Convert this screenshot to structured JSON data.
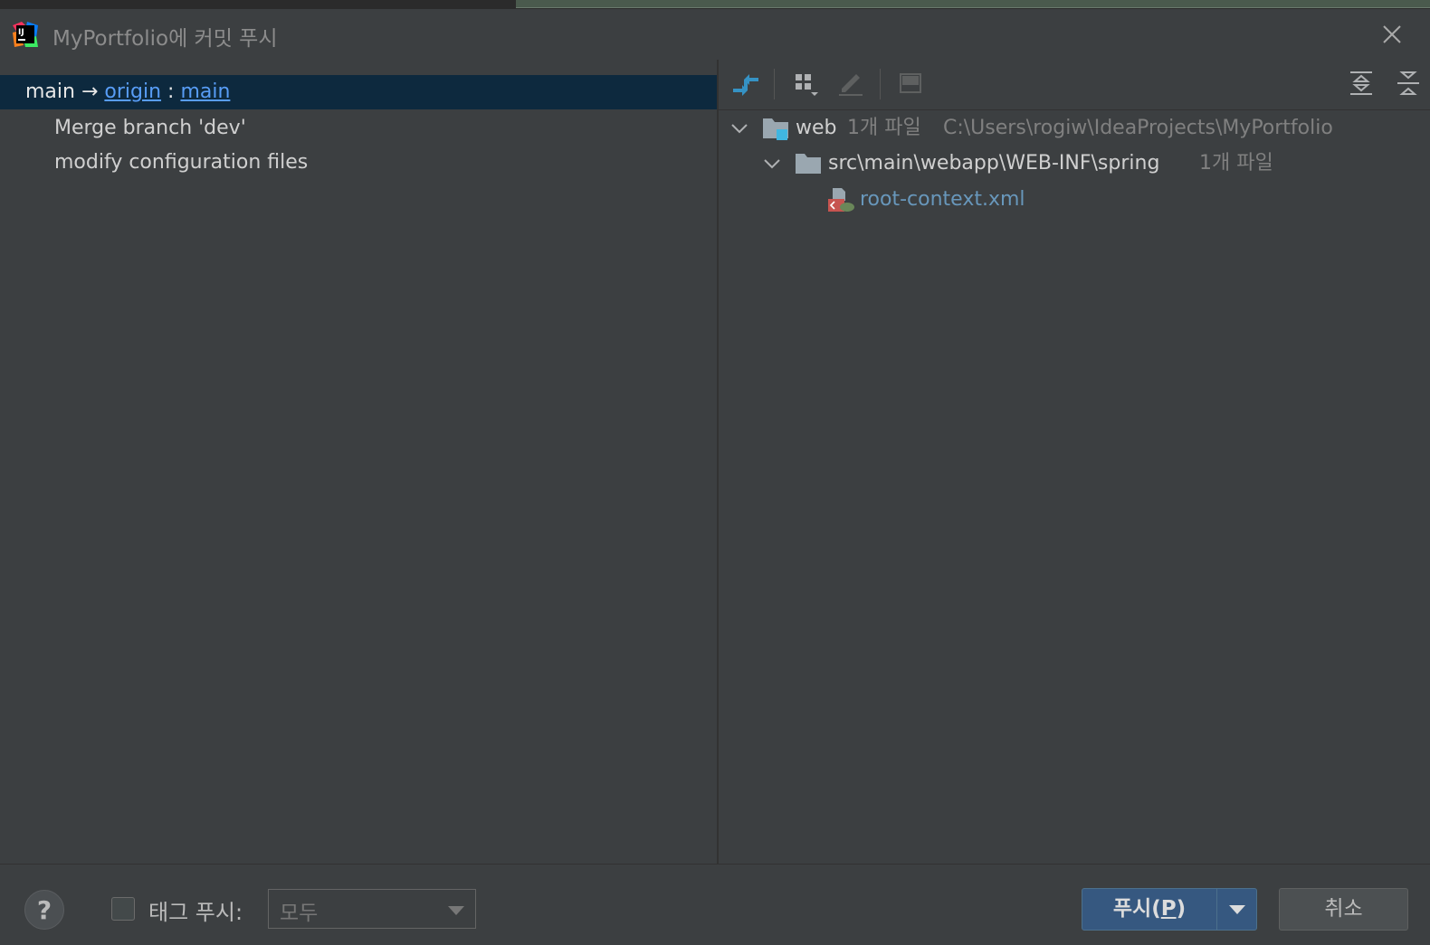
{
  "dialog": {
    "title": "MyPortfolio에 커밋 푸시",
    "close_icon": "close-icon"
  },
  "commits": {
    "head": {
      "local_branch": "main",
      "arrow": " → ",
      "remote": "origin",
      "separator": " : ",
      "remote_branch": "main"
    },
    "items": [
      {
        "message": "Merge branch 'dev'"
      },
      {
        "message": "modify configuration files"
      }
    ]
  },
  "toolbar": {
    "icons": [
      "compare-icon",
      "group-by-icon",
      "edit-icon",
      "preview-diff-icon",
      "expand-all-icon",
      "collapse-all-icon"
    ]
  },
  "changes": {
    "root": {
      "name": "web",
      "count": "1개 파일",
      "path": "C:\\Users\\rogiw\\IdeaProjects\\MyPortfolio"
    },
    "folder": {
      "name": "src\\main\\webapp\\WEB-INF\\spring",
      "count": "1개 파일"
    },
    "file": {
      "name": "root-context.xml"
    }
  },
  "footer": {
    "help": "?",
    "tag_label": "태그 푸시:",
    "tag_option": "모두",
    "push_label": "푸시(",
    "push_mnemonic": "P",
    "push_label_end": ")",
    "cancel_label": "취소"
  },
  "colors": {
    "background": "#3c3f41",
    "selection": "#0d293e",
    "link": "#589df6",
    "primary_button": "#365880"
  }
}
